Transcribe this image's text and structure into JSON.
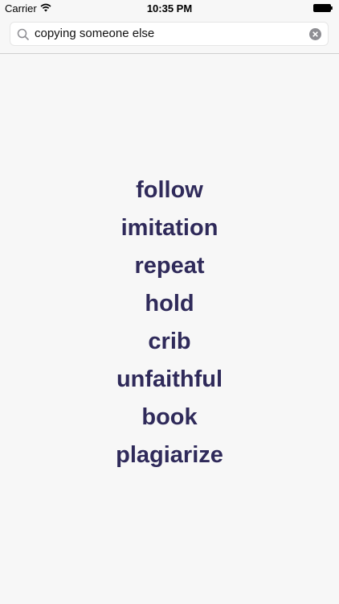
{
  "status_bar": {
    "carrier": "Carrier",
    "time": "10:35 PM"
  },
  "search": {
    "query": "copying someone else"
  },
  "results": [
    "follow",
    "imitation",
    "repeat",
    "hold",
    "crib",
    "unfaithful",
    "book",
    "plagiarize"
  ],
  "colors": {
    "result_text": "#2f2a5a",
    "background": "#f7f7f7"
  }
}
